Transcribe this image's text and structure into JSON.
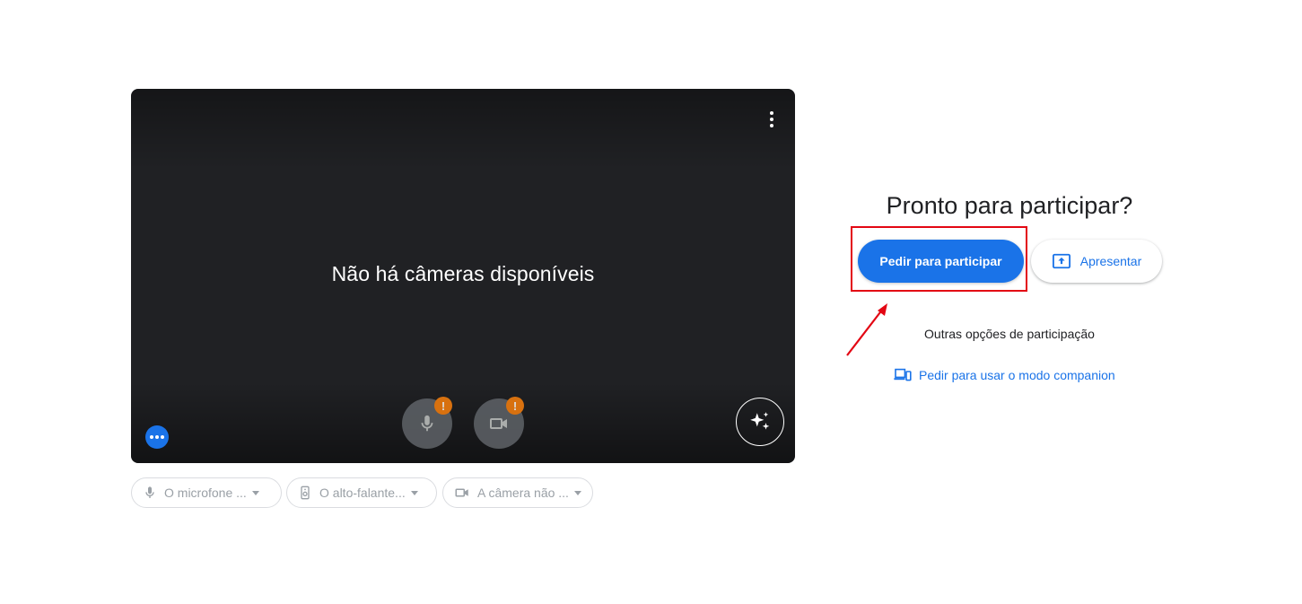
{
  "preview": {
    "no_camera_text": "Não há câmeras disponíveis",
    "mic_warning": "!",
    "camera_warning": "!"
  },
  "devices": {
    "microphone_label": "O microfone ...",
    "speaker_label": "O alto-falante...",
    "camera_label": "A câmera não ..."
  },
  "join": {
    "title": "Pronto para participar?",
    "join_button_label": "Pedir para participar",
    "present_button_label": "Apresentar",
    "other_options_label": "Outras opções de participação",
    "companion_link_label": "Pedir para usar o modo companion"
  },
  "icons": {
    "more_options": "more-vert-icon",
    "dots_badge": "more-horiz-icon",
    "microphone": "microphone-icon",
    "camera": "video-camera-icon",
    "effects": "sparkle-icon",
    "speaker": "speaker-icon",
    "present": "present-screen-icon",
    "companion": "devices-icon"
  },
  "colors": {
    "accent": "#1a73e8",
    "preview_bg": "#202124",
    "warning": "#f9800d",
    "annotation": "#e30613"
  }
}
